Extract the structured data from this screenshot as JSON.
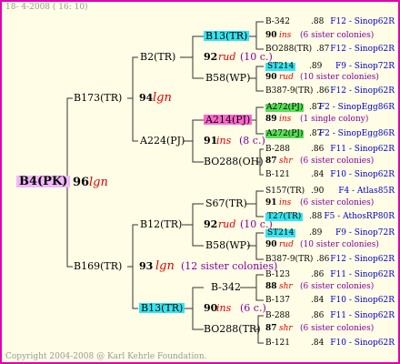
{
  "header": "18-  4-2008 ( 16: 10)",
  "footer": "Copyright 2004-2008 @ Karl Kehrle Foundation.",
  "root": {
    "name": "B4(PK)",
    "year": "96",
    "breeder": "lgn"
  },
  "gen1": [
    {
      "name": "B173(TR)",
      "year": "94",
      "breeder": "lgn"
    },
    {
      "name": "B169(TR)",
      "year": "93",
      "breeder": "lgn",
      "note": "(12 sister colonies)"
    }
  ],
  "gen2": [
    {
      "name": "B2(TR)",
      "year": "92",
      "breeder": "rud",
      "note": "(10 c.)"
    },
    {
      "name": "A224(PJ)",
      "year": "91",
      "breeder": "ins",
      "note": "(8 c.)"
    },
    {
      "name": "B12(TR)",
      "year": "92",
      "breeder": "rud",
      "note": "(10 c.)"
    },
    {
      "name": "B13(TR)",
      "year": "90",
      "breeder": "ins",
      "note": "(6 c.)"
    }
  ],
  "gen3": [
    {
      "name": "B13(TR)",
      "year": "90",
      "breeder": "ins",
      "note": "(6 sister colonies)"
    },
    {
      "name": "B58(WP)",
      "year": "90",
      "breeder": "rud",
      "note": "(10 sister colonies)"
    },
    {
      "name": "A214(PJ)",
      "year": "89",
      "breeder": "ins",
      "note": "(1 single colony)"
    },
    {
      "name": "BO288(OH)",
      "year": "87",
      "breeder": "shr",
      "note": "(6 sister colonies)"
    },
    {
      "name": "S67(TR)",
      "year": "91",
      "breeder": "ins",
      "note": "(6 sister colonies)"
    },
    {
      "name": "B58(WP)",
      "year": "90",
      "breeder": "rud",
      "note": "(10 sister colonies)"
    },
    {
      "name": "B-342",
      "year": "88",
      "breeder": "shr",
      "note": "(6 sister colonies)"
    },
    {
      "name": "BO288(TR)",
      "year": "87",
      "breeder": "shr",
      "note": "(6 sister colonies)"
    }
  ],
  "gen4": [
    {
      "name": "B-342",
      "year": ".88",
      "ref": "F12 - Sinop62R"
    },
    {
      "name": "BO288(TR)",
      "year": ".87",
      "ref": "F12 - Sinop62R"
    },
    {
      "name": "ST214",
      "year": ".89",
      "ref": "F9 - Sinop72R"
    },
    {
      "name": "B387-9(TR)",
      "year": ".86",
      "ref": "F12 - Sinop62R"
    },
    {
      "name": "A272(PJ)",
      "year": ".87",
      "ref": "F2 - SinopEgg86R"
    },
    {
      "name": "A272(PJ)",
      "year": ".87",
      "ref": "F2 - SinopEgg86R"
    },
    {
      "name": "B-288",
      "year": ".86",
      "ref": "F11 - Sinop62R"
    },
    {
      "name": "B-121",
      "year": ".84",
      "ref": "F10 - Sinop62R"
    },
    {
      "name": "S157(TR)",
      "year": ".90",
      "ref": "F4 - Atlas85R"
    },
    {
      "name": "T27(TR)",
      "year": ".88",
      "ref": "F5 - AthosRP80R"
    },
    {
      "name": "ST214",
      "year": ".89",
      "ref": "F9 - Sinop72R"
    },
    {
      "name": "B387-9(TR)",
      "year": ".86",
      "ref": "F12 - Sinop62R"
    },
    {
      "name": "B-123",
      "year": ".86",
      "ref": "F11 - Sinop62R"
    },
    {
      "name": "B-137",
      "year": ".84",
      "ref": "F10 - Sinop62R"
    },
    {
      "name": "B-288",
      "year": ".86",
      "ref": "F11 - Sinop62R"
    },
    {
      "name": "B-121",
      "year": ".84",
      "ref": "F10 - Sinop62R"
    }
  ]
}
